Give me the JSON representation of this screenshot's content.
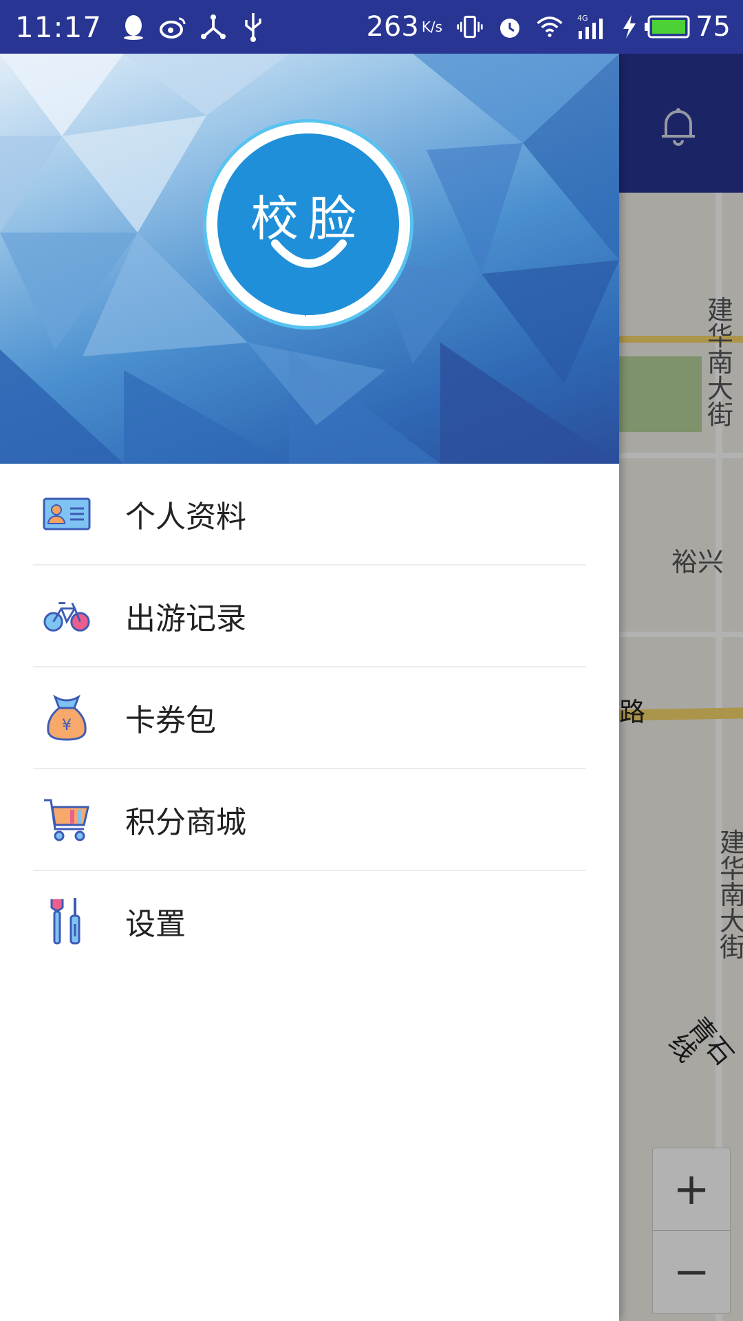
{
  "status_bar": {
    "time": "11:17",
    "net_speed": "263",
    "net_speed_unit": "K/s",
    "network_type": "4G",
    "battery_level": "75",
    "icons": [
      "qq-icon",
      "weibo-icon",
      "usb-debug-icon",
      "usb-icon",
      "vibrate-icon",
      "alarm-icon",
      "wifi-icon",
      "signal-icon",
      "charging-icon",
      "battery-icon"
    ]
  },
  "map": {
    "labels": {
      "road1": "建华南大街",
      "road2": "裕兴",
      "road3": "路",
      "road4": "建华南大街",
      "road5": "青石线"
    },
    "zoom_in": "+",
    "zoom_out": "−"
  },
  "drawer": {
    "logo_text": "校脸",
    "items": [
      {
        "label": "个人资料",
        "icon": "id-card-icon"
      },
      {
        "label": "出游记录",
        "icon": "bicycle-icon"
      },
      {
        "label": "卡券包",
        "icon": "money-bag-icon"
      },
      {
        "label": "积分商城",
        "icon": "shopping-cart-icon"
      },
      {
        "label": "设置",
        "icon": "tools-icon"
      }
    ]
  },
  "colors": {
    "status_bar": "#283593",
    "logo_blue": "#1e8fd8",
    "ring": "#58c3f0"
  }
}
